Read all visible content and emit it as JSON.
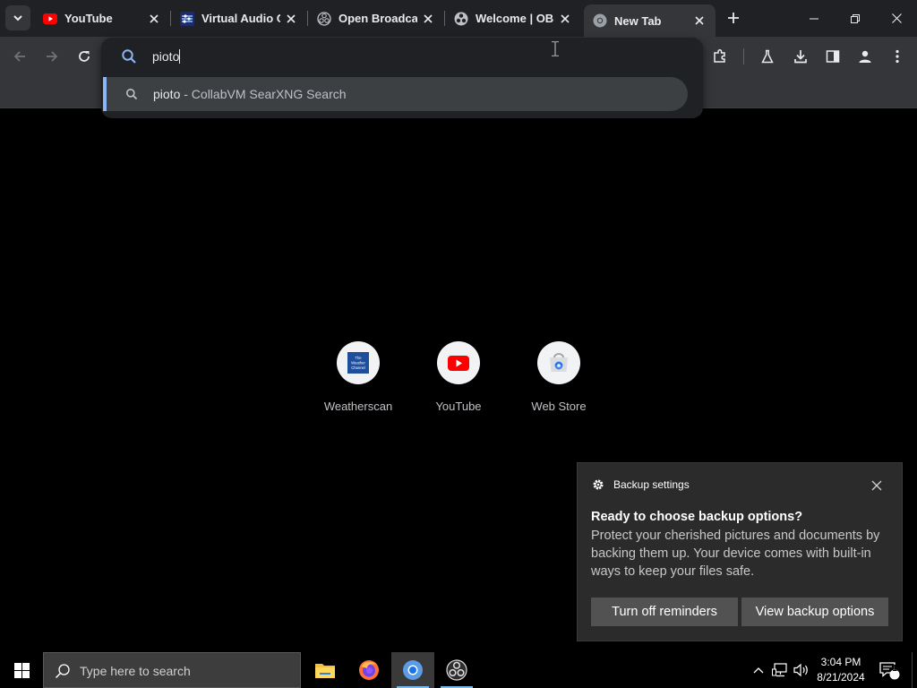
{
  "browser": {
    "tabs": [
      {
        "title": "YouTube",
        "icon": "youtube-icon"
      },
      {
        "title": "Virtual Audio C",
        "icon": "vb-audio-icon"
      },
      {
        "title": "Open Broadcas",
        "icon": "obs-icon"
      },
      {
        "title": "Welcome | OBS",
        "icon": "obs-icon"
      },
      {
        "title": "New Tab",
        "icon": "chrome-icon",
        "active": true
      }
    ],
    "omnibox": {
      "text": "pioto",
      "suggestion_query": "pioto",
      "suggestion_source": " - CollabVM SearXNG Search"
    }
  },
  "new_tab": {
    "shortcuts": [
      {
        "label": "Weatherscan",
        "icon": "weather-channel-icon",
        "logo_text": "The Weather Channel"
      },
      {
        "label": "YouTube",
        "icon": "youtube-icon"
      },
      {
        "label": "Web Store",
        "icon": "web-store-icon"
      }
    ]
  },
  "notification": {
    "app": "Backup settings",
    "title": "Ready to choose backup options?",
    "body": "Protect your cherished pictures and documents by backing them up. Your device comes with built-in ways to keep your files safe.",
    "button_dismiss": "Turn off reminders",
    "button_action": "View backup options"
  },
  "taskbar": {
    "search_placeholder": "Type here to search",
    "time": "3:04 PM",
    "date": "8/21/2024",
    "notification_count": "1",
    "apps": [
      "file-explorer-icon",
      "firefox-icon",
      "chrome-icon",
      "obs-icon"
    ]
  },
  "colors": {
    "accent": "#8ab4f8",
    "youtube_red": "#ff0000",
    "toast_bg": "#2b2b2b",
    "taskbar_bg": "#000000"
  }
}
